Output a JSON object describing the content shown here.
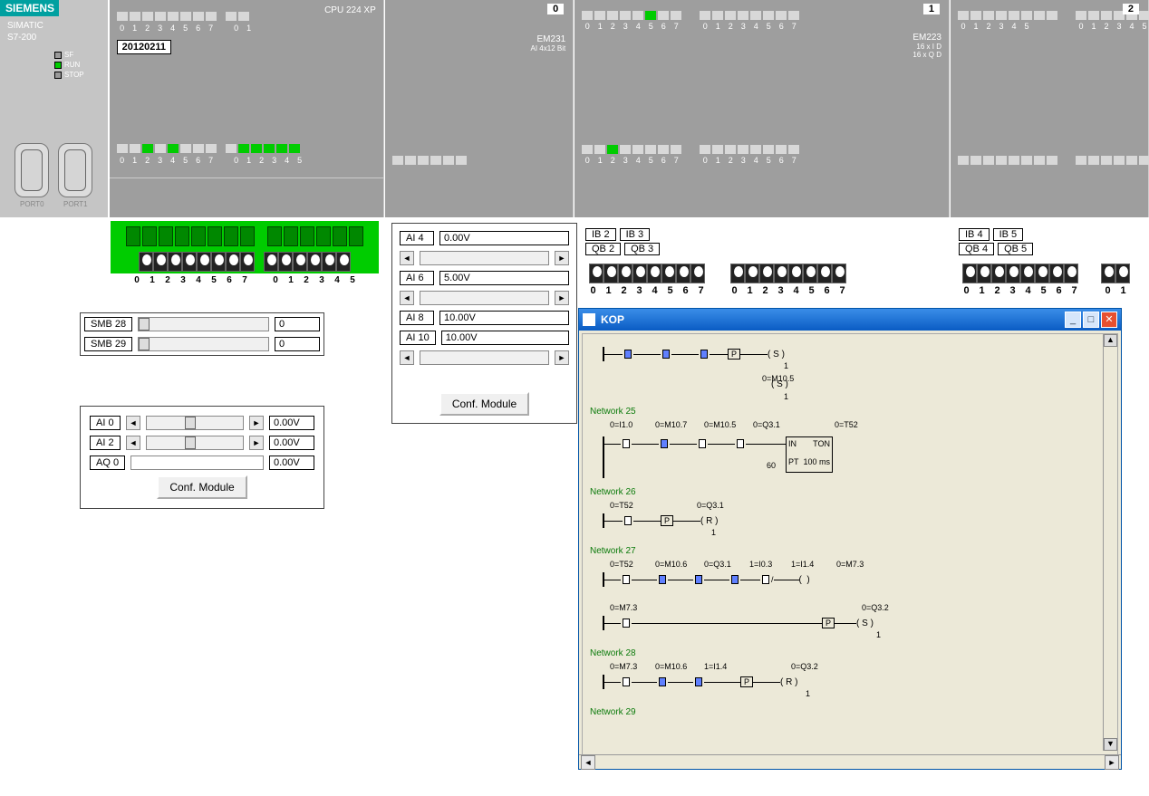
{
  "branding": {
    "logo": "SIEMENS",
    "product": "SIMATIC\nS7-200"
  },
  "status_leds": [
    {
      "name": "SF",
      "on": false
    },
    {
      "name": "RUN",
      "on": true
    },
    {
      "name": "STOP",
      "on": false
    }
  ],
  "ports": [
    "PORT0",
    "PORT1"
  ],
  "cpu": {
    "label": "CPU 224 XP",
    "display": "20120211",
    "di_digits": "0 1 2 3 4 5 6 7",
    "di2_digits": "0 1",
    "do_digits": "0 1 2 3 4 5 6 7",
    "do2_digits": "0 1 2 3 4 5",
    "term_digits": "0 1 2 3 4 5 6 7",
    "term2_digits": "0 1 2 3 4 5"
  },
  "slots": [
    {
      "num": "0",
      "label": "EM231",
      "sub": "AI 4x12 Bit"
    },
    {
      "num": "1",
      "label": "EM223",
      "sub": "16 x I D\n16 x Q D"
    },
    {
      "num": "2",
      "label": ""
    }
  ],
  "slot1_digits": "0 1 2 3 4 5 6 7",
  "smb_panel": {
    "rows": [
      {
        "label": "SMB 28",
        "val": "0"
      },
      {
        "label": "SMB 29",
        "val": "0"
      }
    ]
  },
  "ai_panel_left": {
    "rows": [
      {
        "label": "AI 0",
        "val": "0.00V"
      },
      {
        "label": "AI 2",
        "val": "0.00V"
      }
    ],
    "aq": {
      "label": "AQ 0",
      "val": "0.00V"
    },
    "btn": "Conf. Module"
  },
  "ai_panel_right": {
    "rows": [
      {
        "label": "AI 4",
        "val": "0.00V"
      },
      {
        "label": "AI 6",
        "val": "5.00V"
      },
      {
        "label": "AI 8",
        "val": "10.00V"
      },
      {
        "label": "AI 10",
        "val": "10.00V"
      }
    ],
    "btn": "Conf. Module"
  },
  "iobq_mod1": {
    "r1": [
      "IB 2",
      "IB 3"
    ],
    "r2": [
      "QB 2",
      "QB 3"
    ],
    "digits": "0 1 2 3 4 5 6 7",
    "digits2": "0 1 2 3 4 5 6 7"
  },
  "iobq_mod2": {
    "r1": [
      "IB 4",
      "IB 5"
    ],
    "r2": [
      "QB 4",
      "QB 5"
    ],
    "digits": "0 1 2 3 4 5 6 7",
    "digits2": "0 1"
  },
  "kop": {
    "title": "KOP",
    "networks": [
      {
        "name": "",
        "tags": [
          "",
          "",
          "",
          "P",
          "( S )",
          "1",
          "0=M10.5",
          "( S )",
          "1"
        ]
      },
      {
        "name": "Network 25",
        "tags": [
          "0=I1.0",
          "0=M10.7",
          "0=M10.5",
          "0=Q3.1",
          "0=T52"
        ],
        "ton": {
          "in": "IN",
          "type": "TON",
          "pt": "PT",
          "pt_val": "60",
          "unit": "100 ms"
        }
      },
      {
        "name": "Network 26",
        "tags": [
          "0=T52",
          "0=Q3.1",
          "P",
          "( R )",
          "1"
        ]
      },
      {
        "name": "Network 27",
        "tags": [
          "0=T52",
          "0=M10.6",
          "0=Q3.1",
          "1=I0.3",
          "1=I1.4",
          "0=M7.3"
        ],
        "branch": [
          "0=M7.3",
          "0=Q3.2",
          "P",
          "( S )",
          "1"
        ]
      },
      {
        "name": "Network 28",
        "tags": [
          "0=M7.3",
          "0=M10.6",
          "1=I1.4",
          "0=Q3.2",
          "P",
          "( R )",
          "1"
        ]
      },
      {
        "name": "Network 29"
      }
    ]
  }
}
